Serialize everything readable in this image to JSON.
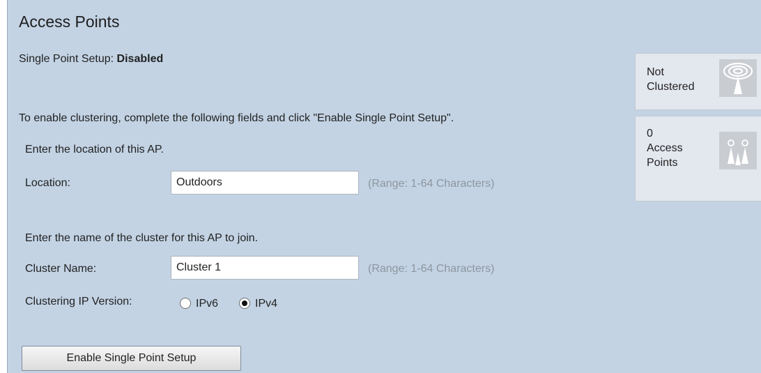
{
  "page": {
    "title": "Access Points"
  },
  "status": {
    "label": "Single Point Setup: ",
    "value": "Disabled"
  },
  "intro": "To enable clustering, complete the following fields and click \"Enable Single Point Setup\".",
  "location": {
    "hint": "Enter the location of this AP.",
    "label": "Location:",
    "value": "Outdoors",
    "range": "(Range: 1-64 Characters)"
  },
  "cluster": {
    "hint": "Enter the name of the cluster for this AP to join.",
    "label": "Cluster Name:",
    "value": "Cluster 1",
    "range": "(Range: 1-64 Characters)"
  },
  "ip_version": {
    "label": "Clustering IP Version:",
    "options": [
      {
        "label": "IPv6",
        "checked": false
      },
      {
        "label": "IPv4",
        "checked": true
      }
    ]
  },
  "enable_button": {
    "label": "Enable Single Point Setup"
  },
  "status_cards": {
    "cluster_state": {
      "text": "Not\nClustered",
      "icon": "signal-tower-icon"
    },
    "ap_count": {
      "count": "0",
      "text": "Access\nPoints",
      "icon": "access-points-icon"
    }
  },
  "colors": {
    "panel_bg": "#c3d3e4",
    "card_bg": "#e3e7ee",
    "icon_bg": "#c9ccd1",
    "muted_text": "#8d969f"
  }
}
